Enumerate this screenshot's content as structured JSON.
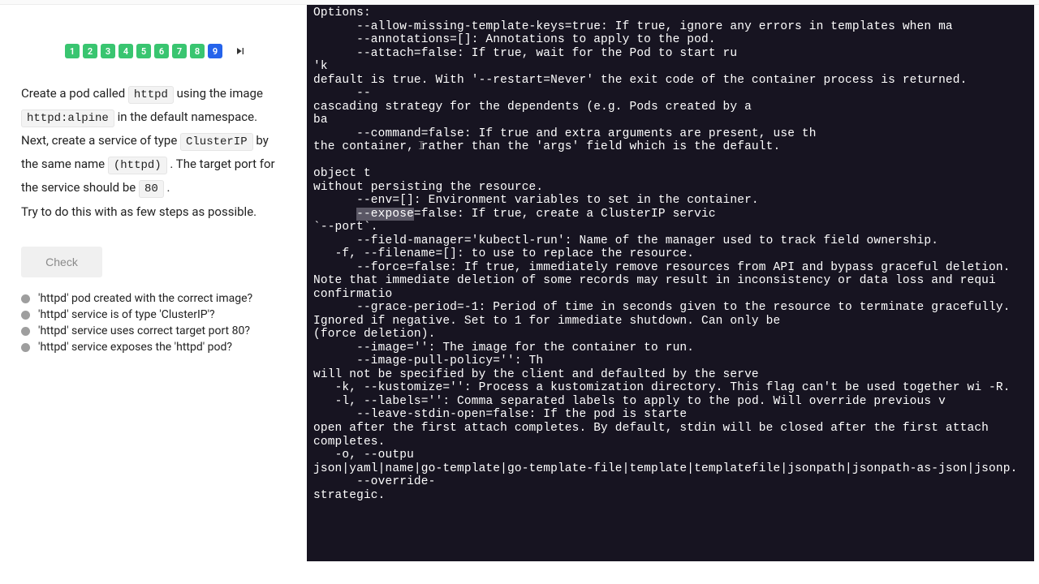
{
  "pagination": {
    "pages": [
      {
        "n": "1",
        "state": "done"
      },
      {
        "n": "2",
        "state": "done"
      },
      {
        "n": "3",
        "state": "done"
      },
      {
        "n": "4",
        "state": "done"
      },
      {
        "n": "5",
        "state": "done"
      },
      {
        "n": "6",
        "state": "done"
      },
      {
        "n": "7",
        "state": "done"
      },
      {
        "n": "8",
        "state": "done"
      },
      {
        "n": "9",
        "state": "current"
      }
    ]
  },
  "instructions": {
    "line1a": "Create a pod called ",
    "code1": "httpd",
    "line1b": " using the image ",
    "code2": "httpd:alpine",
    "line1c": " in the default namespace. Next, create a service of type ",
    "code3": "ClusterIP",
    "line1d": " by the same name ",
    "code4": "(httpd)",
    "line1e": " . The target port for the service should be ",
    "code5": "80",
    "line1f": " .",
    "line2": "Try to do this with as few steps as possible."
  },
  "check_label": "Check",
  "checklist": [
    "'httpd' pod created with the correct image?",
    "'httpd' service is of type 'ClusterIP'?",
    "'httpd' service uses correct target port 80?",
    "'httpd' service exposes the 'httpd' pod?"
  ],
  "terminal": {
    "pre_hl": "Options:\n      --allow-missing-template-keys=true: If true, ignore any errors in templates when ma\n      --annotations=[]: Annotations to apply to the pod.\n      --attach=false: If true, wait for the Pod to start ru\n'k\ndefault is true. With '--restart=Never' the exit code of the container process is returned.\n      --\ncascading strategy for the dependents (e.g. Pods created by a\nba\n      --command=false: If true and extra arguments are present, use th\nthe container, rather than the 'args' field which is the default.\n\nobject t\nwithout persisting the resource.\n      --env=[]: Environment variables to set in the container.\n      ",
    "hl": "--expose",
    "post_hl": "=false: If true, create a ClusterIP servic\n`--port`.\n      --field-manager='kubectl-run': Name of the manager used to track field ownership.\n   -f, --filename=[]: to use to replace the resource.\n      --force=false: If true, immediately remove resources from API and bypass graceful deletion. Note that immediate deletion of some records may result in inconsistency or data loss and requi confirmatio\n      --grace-period=-1: Period of time in seconds given to the resource to terminate gracefully. Ignored if negative. Set to 1 for immediate shutdown. Can only be\n(force deletion).\n      --image='': The image for the container to run.\n      --image-pull-policy='': Th\nwill not be specified by the client and defaulted by the serve\n   -k, --kustomize='': Process a kustomization directory. This flag can't be used together wi -R.\n   -l, --labels='': Comma separated labels to apply to the pod. Will override previous v\n      --leave-stdin-open=false: If the pod is starte\nopen after the first attach completes. By default, stdin will be closed after the first attach completes.\n   -o, --outpu\njson|yaml|name|go-template|go-template-file|template|templatefile|jsonpath|jsonpath-as-json|jsonp.\n      --override-\nstrategic."
  }
}
